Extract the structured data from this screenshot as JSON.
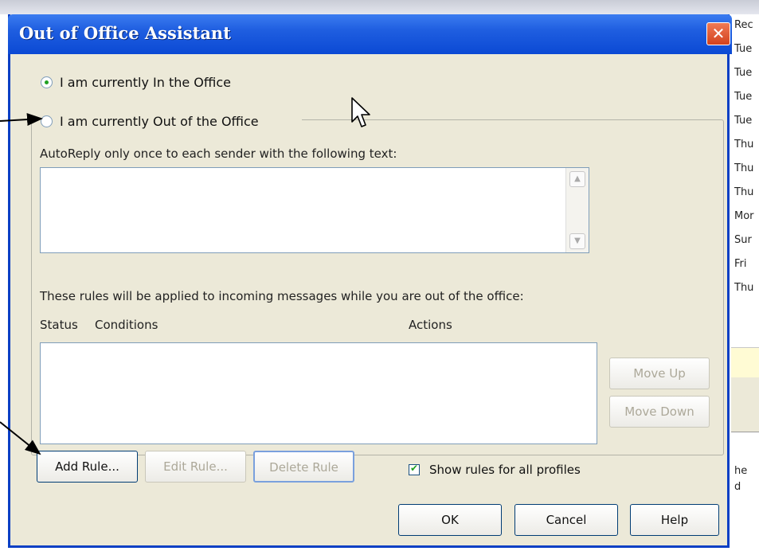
{
  "dialog": {
    "title": "Out of Office Assistant",
    "close_glyph": "✕"
  },
  "options": {
    "in_office_label": "I am currently In the Office",
    "out_office_label": "I am currently Out of the Office",
    "selected": "in_office"
  },
  "autoreply": {
    "label": "AutoReply only once to each sender with the following text:",
    "value": ""
  },
  "rules": {
    "description": "These rules will be applied to incoming messages while you are out of the office:",
    "columns": [
      "Status",
      "Conditions",
      "Actions"
    ],
    "rows": []
  },
  "buttons": {
    "move_up": "Move Up",
    "move_down": "Move Down",
    "add_rule": "Add Rule...",
    "edit_rule": "Edit Rule...",
    "delete_rule": "Delete Rule",
    "ok": "OK",
    "cancel": "Cancel",
    "help": "Help"
  },
  "show_rules_checkbox": {
    "label": "Show rules for all profiles",
    "checked": true
  },
  "background_window": {
    "header": "Rec",
    "items": [
      "Tue",
      "Tue",
      "Tue",
      "Tue",
      "Thu",
      "Thu",
      "Thu",
      "Mor",
      "Sur",
      "Fri",
      "Thu"
    ],
    "bottom_lines": [
      "he",
      "d"
    ]
  },
  "colors": {
    "titlebar": "#0b49d4",
    "dialog_bg": "#ece9d8",
    "close_button": "#d3421d"
  }
}
